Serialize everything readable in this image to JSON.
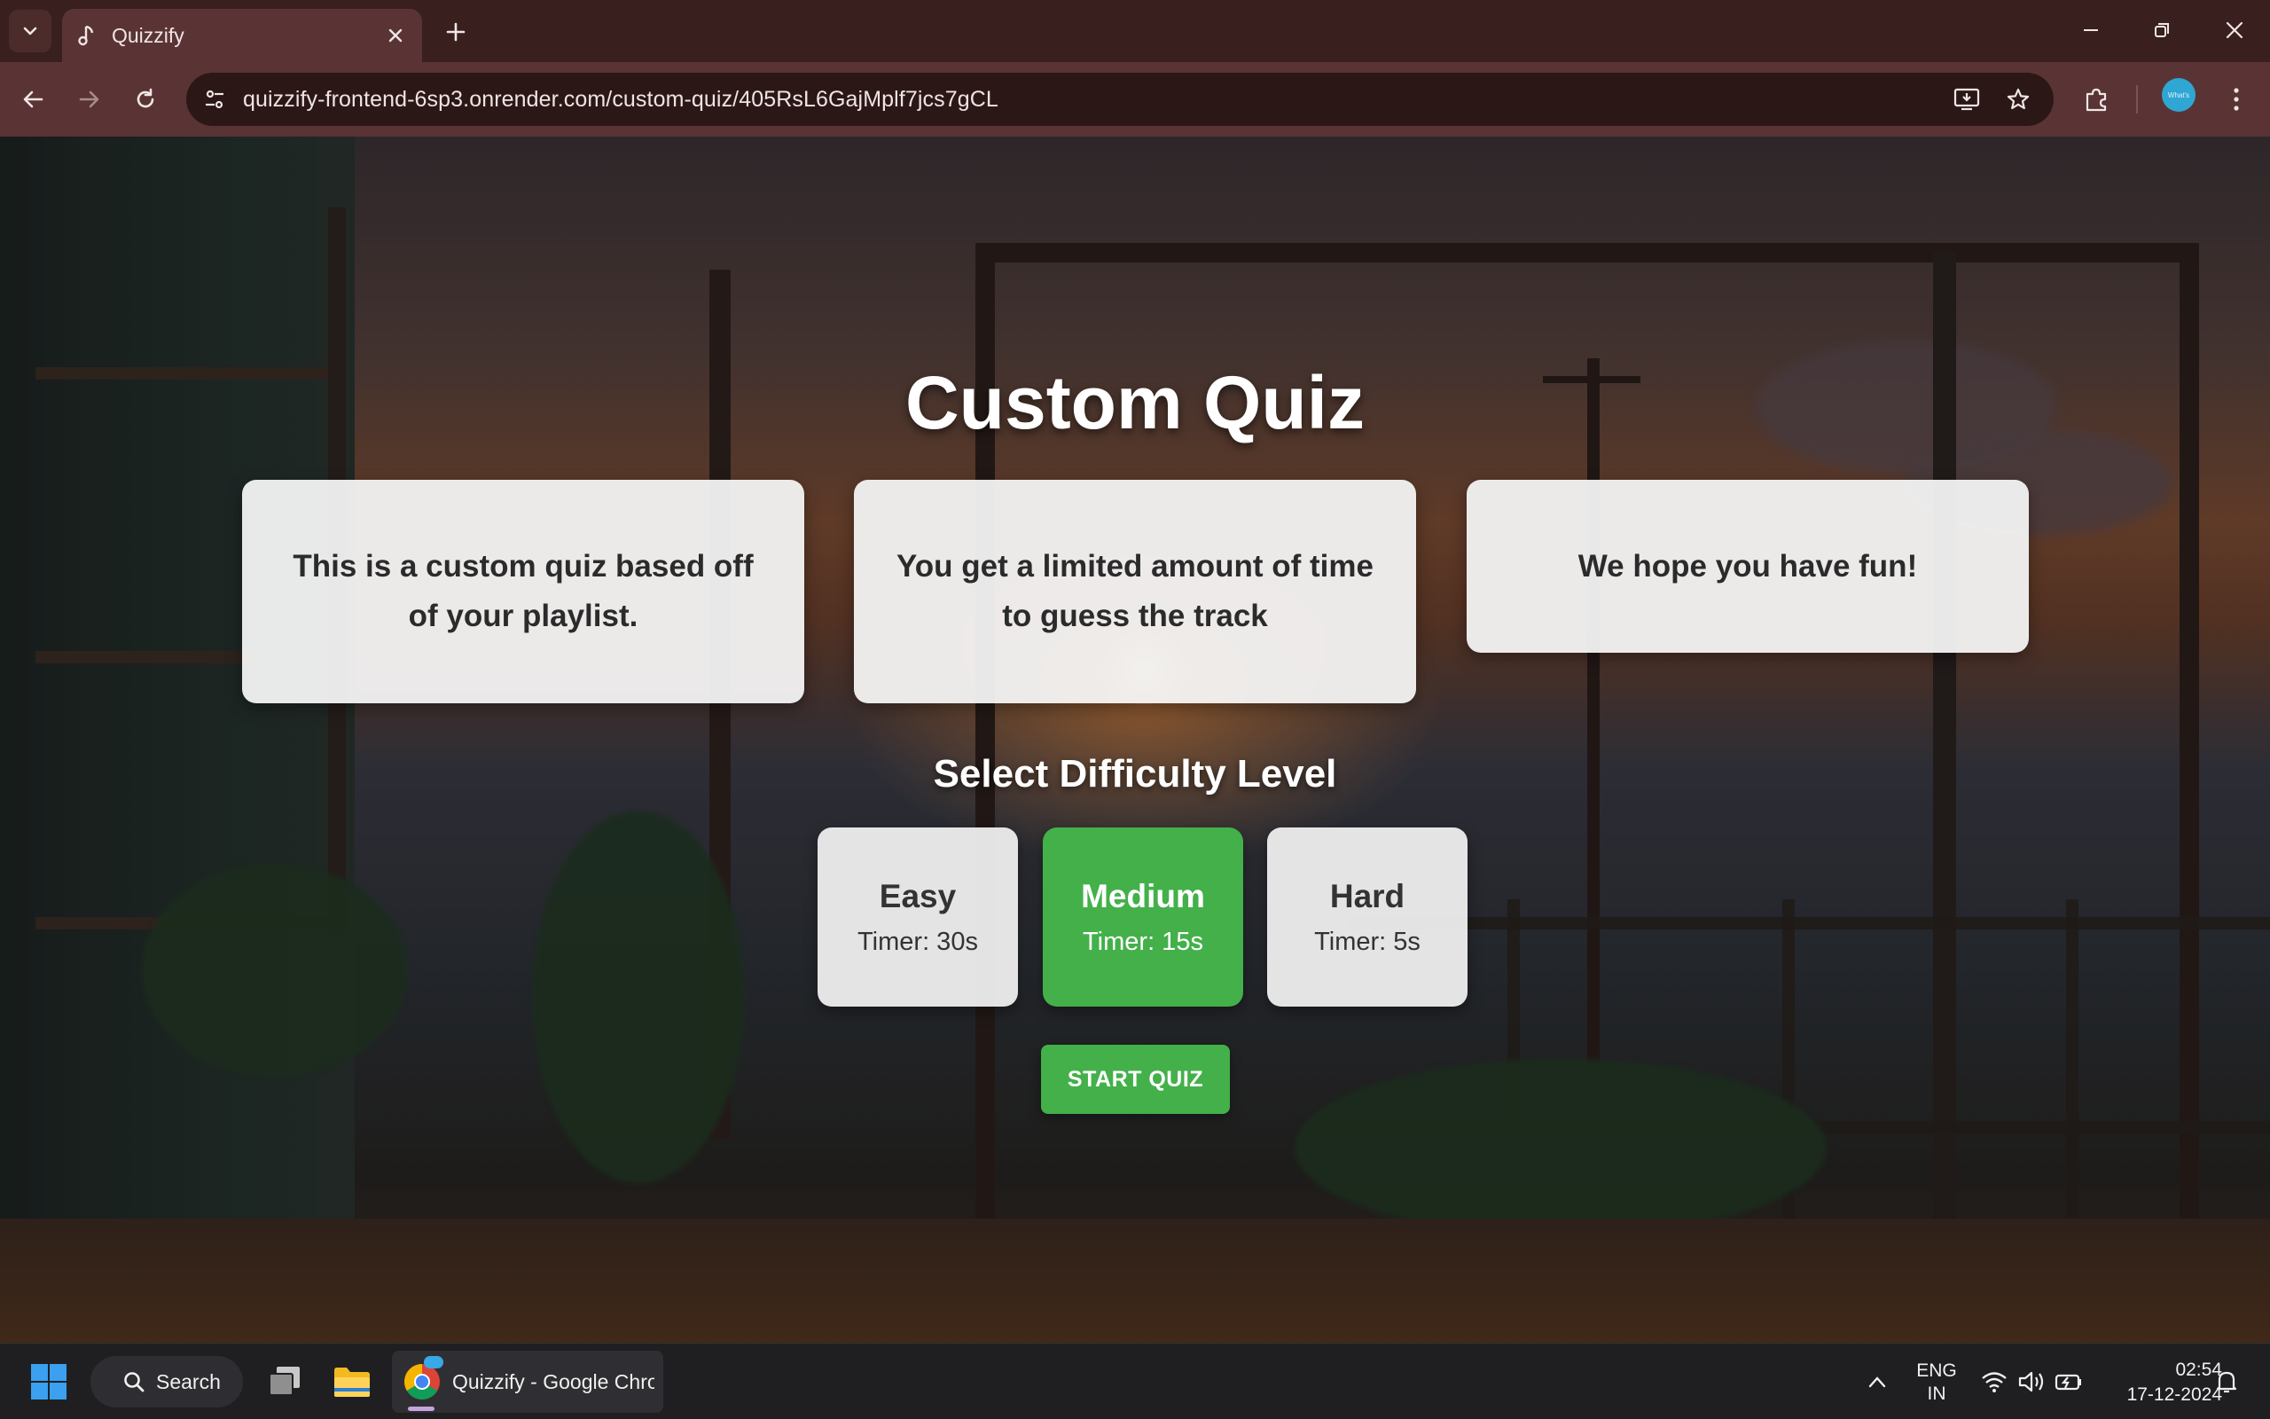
{
  "browser": {
    "tab_title": "Quizzify",
    "url": "quizzify-frontend-6sp3.onrender.com/custom-quiz/405RsL6GajMplf7jcs7gCL",
    "profile_label": "What's"
  },
  "page": {
    "title": "Custom Quiz",
    "info_cards": [
      {
        "text": "This is a custom quiz based off of your playlist."
      },
      {
        "text": "You get a limited amount of time to guess the track"
      },
      {
        "text": "We hope you have fun!"
      }
    ],
    "difficulty_heading": "Select Difficulty Level",
    "difficulties": [
      {
        "name": "Easy",
        "timer": "Timer: 30s",
        "selected": false
      },
      {
        "name": "Medium",
        "timer": "Timer: 15s",
        "selected": true
      },
      {
        "name": "Hard",
        "timer": "Timer: 5s",
        "selected": false
      }
    ],
    "start_label": "START QUIZ",
    "accent_color": "#43b04a"
  },
  "taskbar": {
    "search_label": "Search",
    "chrome_label": "Quizzify - Google Chrome",
    "lang_line1": "ENG",
    "lang_line2": "IN",
    "time": "02:54",
    "date": "17-12-2024"
  }
}
